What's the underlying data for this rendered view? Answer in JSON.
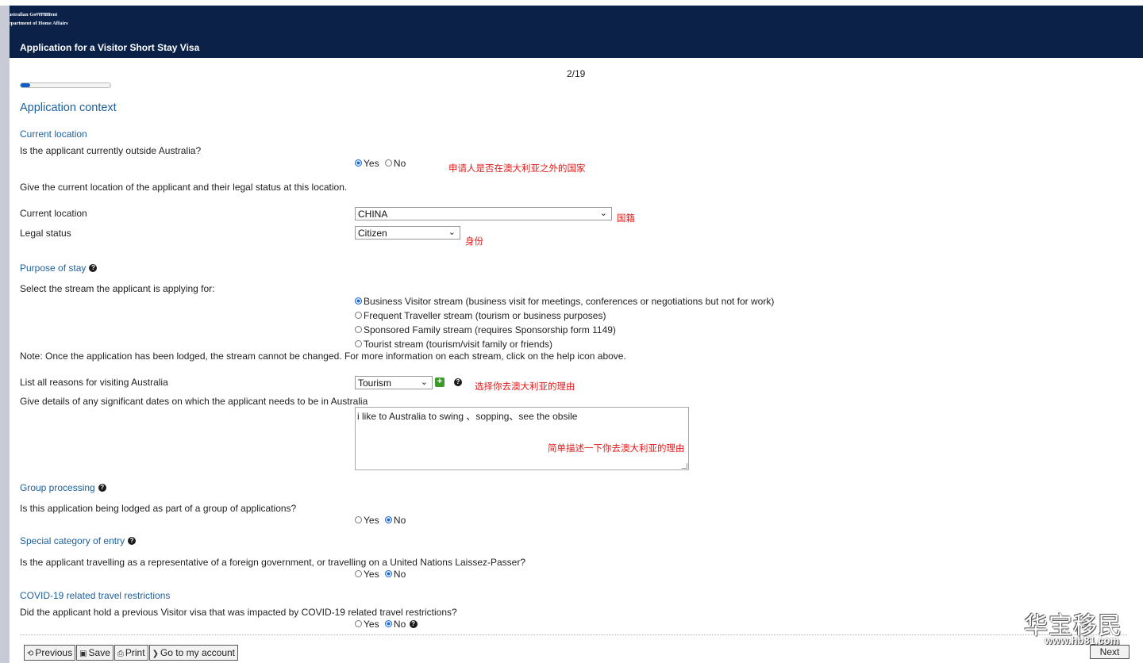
{
  "header": {
    "gov_line1": "Australian Government",
    "gov_line2": "Department of Home Affairs",
    "app_title": "Application for a Visitor Short Stay Visa"
  },
  "progress": {
    "label": "2/19",
    "fraction": 0.105
  },
  "page_heading": "Application context",
  "current_location_section": {
    "title": "Current location",
    "question": "Is the applicant currently outside Australia?",
    "yes_label": "Yes",
    "no_label": "No",
    "selected": "Yes",
    "annotation": "申请人是否在澳大利亚之外的国家",
    "instruction": "Give the current location of the applicant and their legal status at this location.",
    "location_label": "Current location",
    "location_value": "CHINA",
    "location_annotation": "国籍",
    "legal_status_label": "Legal status",
    "legal_status_value": "Citizen",
    "legal_status_annotation": "身份"
  },
  "purpose_section": {
    "title": "Purpose of stay",
    "question": "Select the stream the applicant is applying for:",
    "options": [
      "Business Visitor stream (business visit for meetings, conferences or negotiations but not for work)",
      "Frequent Traveller stream (tourism or business purposes)",
      "Sponsored Family stream (requires Sponsorship form 1149)",
      "Tourist stream (tourism/visit family or friends)"
    ],
    "selected_index": 0,
    "note": "Note: Once the application has been lodged, the stream cannot be changed. For more information on each stream, click on the help icon above.",
    "reasons_label": "List all reasons for visiting Australia",
    "reasons_value": "Tourism",
    "reasons_annotation": "选择你去澳大利亚的理由",
    "dates_label": "Give details of any significant dates on which the applicant needs to be in Australia",
    "dates_value": "i like to Australia to swing 、sopping、see the obsile",
    "dates_annotation": "简单描述一下你去澳大利亚的理由"
  },
  "group_section": {
    "title": "Group processing",
    "question": "Is this application being lodged as part of a group of applications?",
    "yes_label": "Yes",
    "no_label": "No",
    "selected": "No"
  },
  "special_section": {
    "title": "Special category of entry",
    "question": "Is the applicant travelling as a representative of a foreign government, or travelling on a United Nations Laissez-Passer?",
    "yes_label": "Yes",
    "no_label": "No",
    "selected": "No"
  },
  "covid_section": {
    "title": "COVID-19 related travel restrictions",
    "question": "Did the applicant hold a previous Visitor visa that was impacted by COVID-19 related travel restrictions?",
    "yes_label": "Yes",
    "no_label": "No",
    "selected": "No"
  },
  "footer": {
    "previous": "Previous",
    "save": "Save",
    "print": "Print",
    "account": "Go to my account",
    "next": "Next"
  },
  "watermark": {
    "main": "华宝移民",
    "sub": "www.hb81.com"
  },
  "colors": {
    "header_bg": "#0b2147",
    "section_title": "#1d5f9c",
    "annotation": "#e11a1a",
    "progress_fill": "#0c5fcb"
  }
}
